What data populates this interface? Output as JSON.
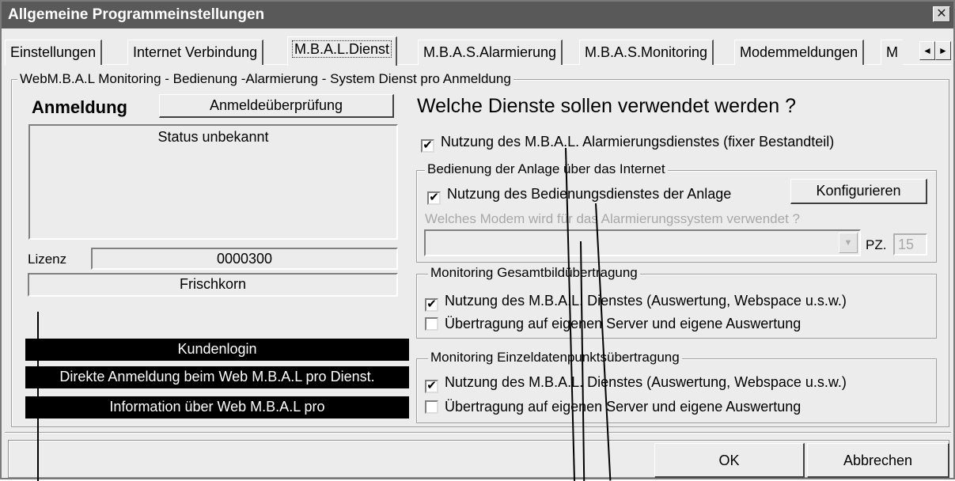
{
  "window": {
    "title": "Allgemeine Programmeinstellungen",
    "close_glyph": "✕"
  },
  "tabs": [
    {
      "label": "Einstellungen"
    },
    {
      "label": "Internet Verbindung"
    },
    {
      "label": "M.B.A.L.Dienst"
    },
    {
      "label": "M.B.A.S.Alarmierung"
    },
    {
      "label": "M.B.A.S.Monitoring"
    },
    {
      "label": "Modemmeldungen"
    },
    {
      "label": "M"
    }
  ],
  "tab_scroll": {
    "left": "◄",
    "right": "►"
  },
  "main_group": {
    "legend": "WebM.B.A.L Monitoring - Bedienung -Alarmierung - System Dienst pro Anmeldung"
  },
  "left": {
    "anmeldung_label": "Anmeldung",
    "check_button": "Anmeldeüberprüfung",
    "status_text": "Status unbekannt",
    "lizenz_label": "Lizenz",
    "lizenz_value": "0000300",
    "name_value": "Frischkorn",
    "kundenlogin": "Kundenlogin",
    "direct_register": "Direkte Anmeldung beim Web M.B.A.L pro  Dienst.",
    "info": "Information über Web M.B.A.L pro"
  },
  "right": {
    "heading": "Welche Dienste sollen verwendet werden ?",
    "alarm_service": {
      "label": "Nutzung des M.B.A.L. Alarmierungsdienstes (fixer Bestandteil)",
      "checked": true,
      "mark": "✔"
    },
    "bedienung": {
      "legend": "Bedienung der Anlage über das Internet",
      "checkbox_label": "Nutzung des Bedienungsdienstes der Anlage",
      "checked": true,
      "configure_button": "Konfigurieren",
      "modem_label": "Welches Modem wird für das Alarmierungssystem verwendet ?",
      "modem_value": "",
      "combo_arrow": "▼",
      "pz_label": "PZ.",
      "pz_value": "15"
    },
    "gesamtbild": {
      "legend": "Monitoring Gesamtbildübertragung",
      "opt1": "Nutzung des M.B.A.L. Dienstes (Auswertung, Webspace u.s.w.)",
      "opt1_checked": true,
      "opt2": "Übertragung auf eigenen Server und eigene Auswertung",
      "opt2_checked": false
    },
    "einzel": {
      "legend": "Monitoring Einzeldatenpunktsübertragung",
      "opt1": "Nutzung des M.B.A.L. Dienstes (Auswertung, Webspace u.s.w.)",
      "opt1_checked": true,
      "opt2": "Übertragung auf eigenen Server und eigene Auswertung",
      "opt2_checked": false
    }
  },
  "footer": {
    "ok": "OK",
    "cancel": "Abbrechen"
  }
}
